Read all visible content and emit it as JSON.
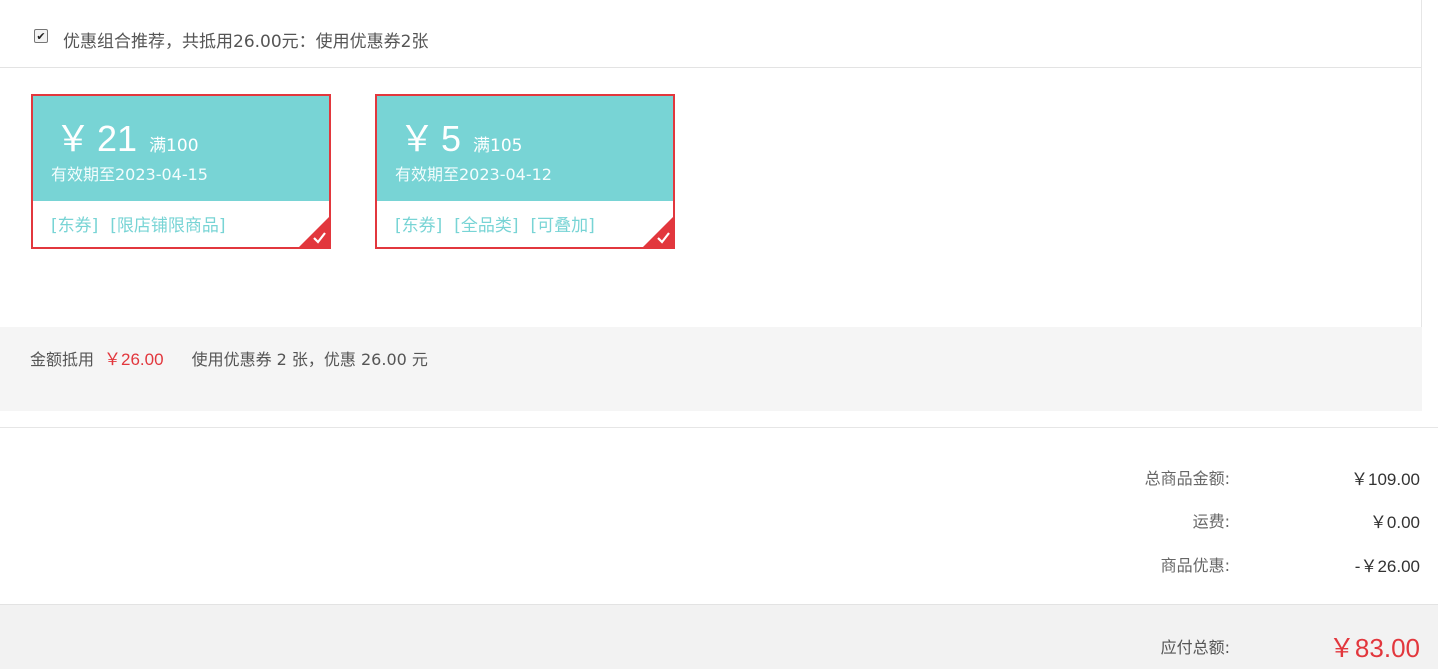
{
  "recommendation": {
    "checked": true,
    "text": "优惠组合推荐，共抵用26.00元：使用优惠券2张"
  },
  "coupons": [
    {
      "currency": "￥",
      "amount": "21",
      "condition": "满100",
      "expiry": "有效期至2023-04-15",
      "tags": [
        "[东券]",
        "[限店铺限商品]"
      ],
      "selected": true
    },
    {
      "currency": "￥",
      "amount": "5",
      "condition": "满105",
      "expiry": "有效期至2023-04-12",
      "tags": [
        "[东券]",
        "[全品类]",
        "[可叠加]"
      ],
      "selected": true
    }
  ],
  "summary": {
    "label": "金额抵用",
    "amount": "￥26.00",
    "detail": "使用优惠券 2 张，优惠 26.00 元"
  },
  "totals": {
    "goods_label": "总商品金额:",
    "goods_value": "￥109.00",
    "shipping_label": "运费:",
    "shipping_value": "￥0.00",
    "discount_label": "商品优惠:",
    "discount_value": "-￥26.00",
    "payable_label": "应付总额:",
    "payable_value": "￥83.00"
  },
  "colors": {
    "coupon_bg": "#78d4d5",
    "accent_red": "#e2373d"
  },
  "icons": {
    "selected_corner": "check-corner-icon",
    "checkbox": "checkbox-checked-icon"
  }
}
